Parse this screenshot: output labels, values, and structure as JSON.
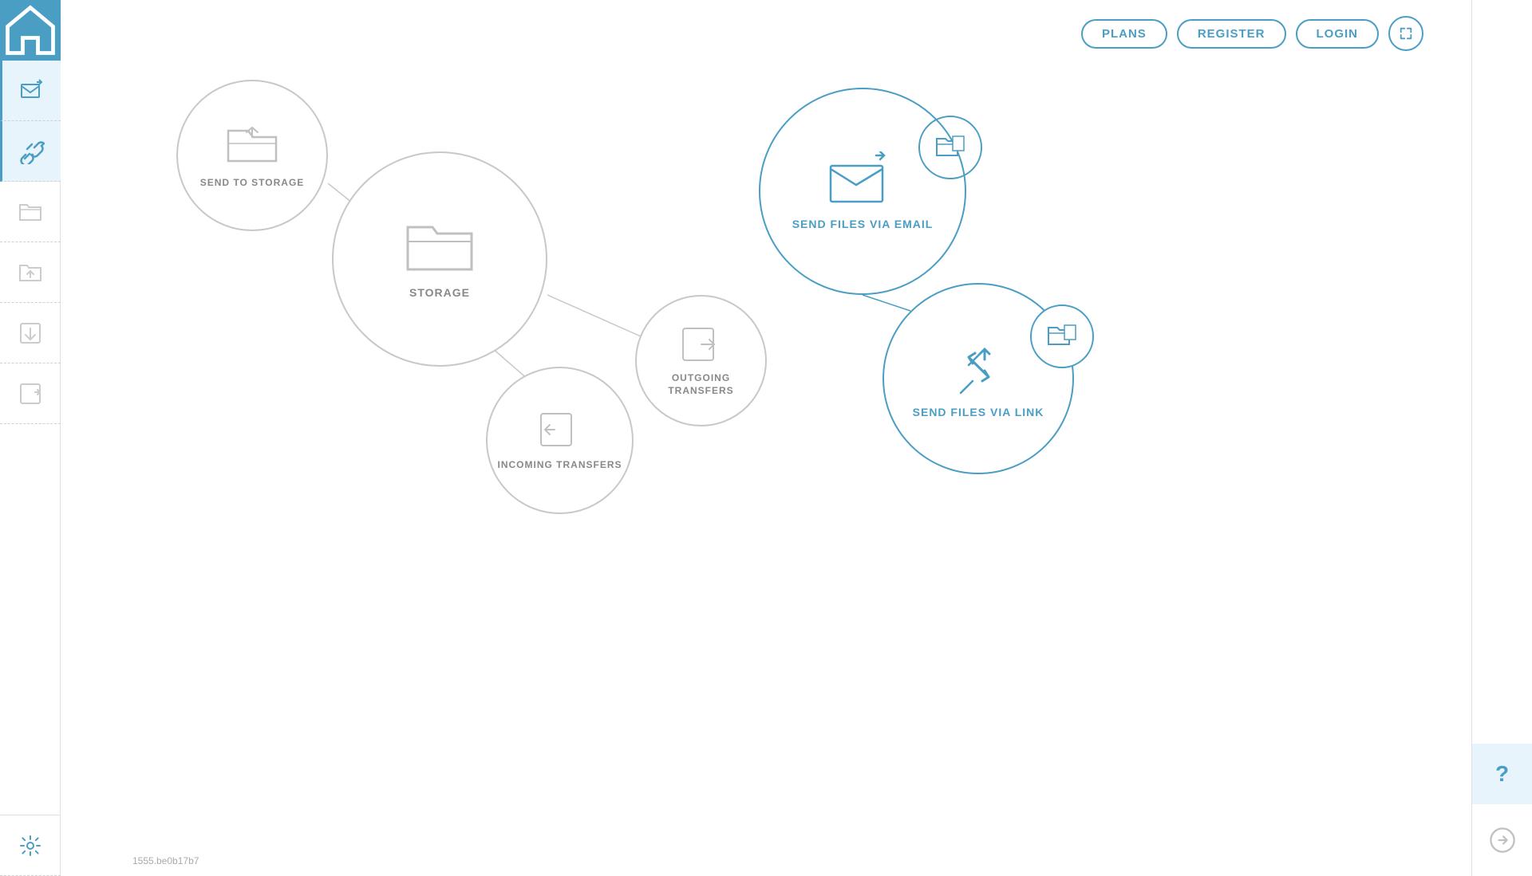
{
  "app": {
    "version": "1555.be0b17b7"
  },
  "header": {
    "plans_label": "PLANS",
    "register_label": "REGISTER",
    "login_label": "LOGIN"
  },
  "nodes": {
    "storage": {
      "label": "STORAGE"
    },
    "send_to_storage": {
      "label": "SEND TO STORAGE"
    },
    "outgoing_transfers": {
      "label": "OUTGOING\nTRANSFERS"
    },
    "incoming_transfers": {
      "label": "INCOMING\nTRANSFERS"
    },
    "send_files_via_email": {
      "label": "SEND FILES VIA EMAIL"
    },
    "send_files_via_link": {
      "label": "SEND FILES VIA LINK"
    }
  },
  "sidebar": {
    "items": [
      {
        "name": "home",
        "icon": "home"
      },
      {
        "name": "send-email",
        "icon": "send-email",
        "active": true
      },
      {
        "name": "link",
        "icon": "link",
        "active": true
      },
      {
        "name": "folder",
        "icon": "folder"
      },
      {
        "name": "upload",
        "icon": "upload"
      },
      {
        "name": "incoming",
        "icon": "incoming"
      },
      {
        "name": "outgoing",
        "icon": "outgoing"
      },
      {
        "name": "settings",
        "icon": "settings"
      }
    ]
  },
  "colors": {
    "blue": "#4a9ec4",
    "gray": "#c8c8c8",
    "text_gray": "#888888",
    "text_blue": "#4a9ec4"
  }
}
